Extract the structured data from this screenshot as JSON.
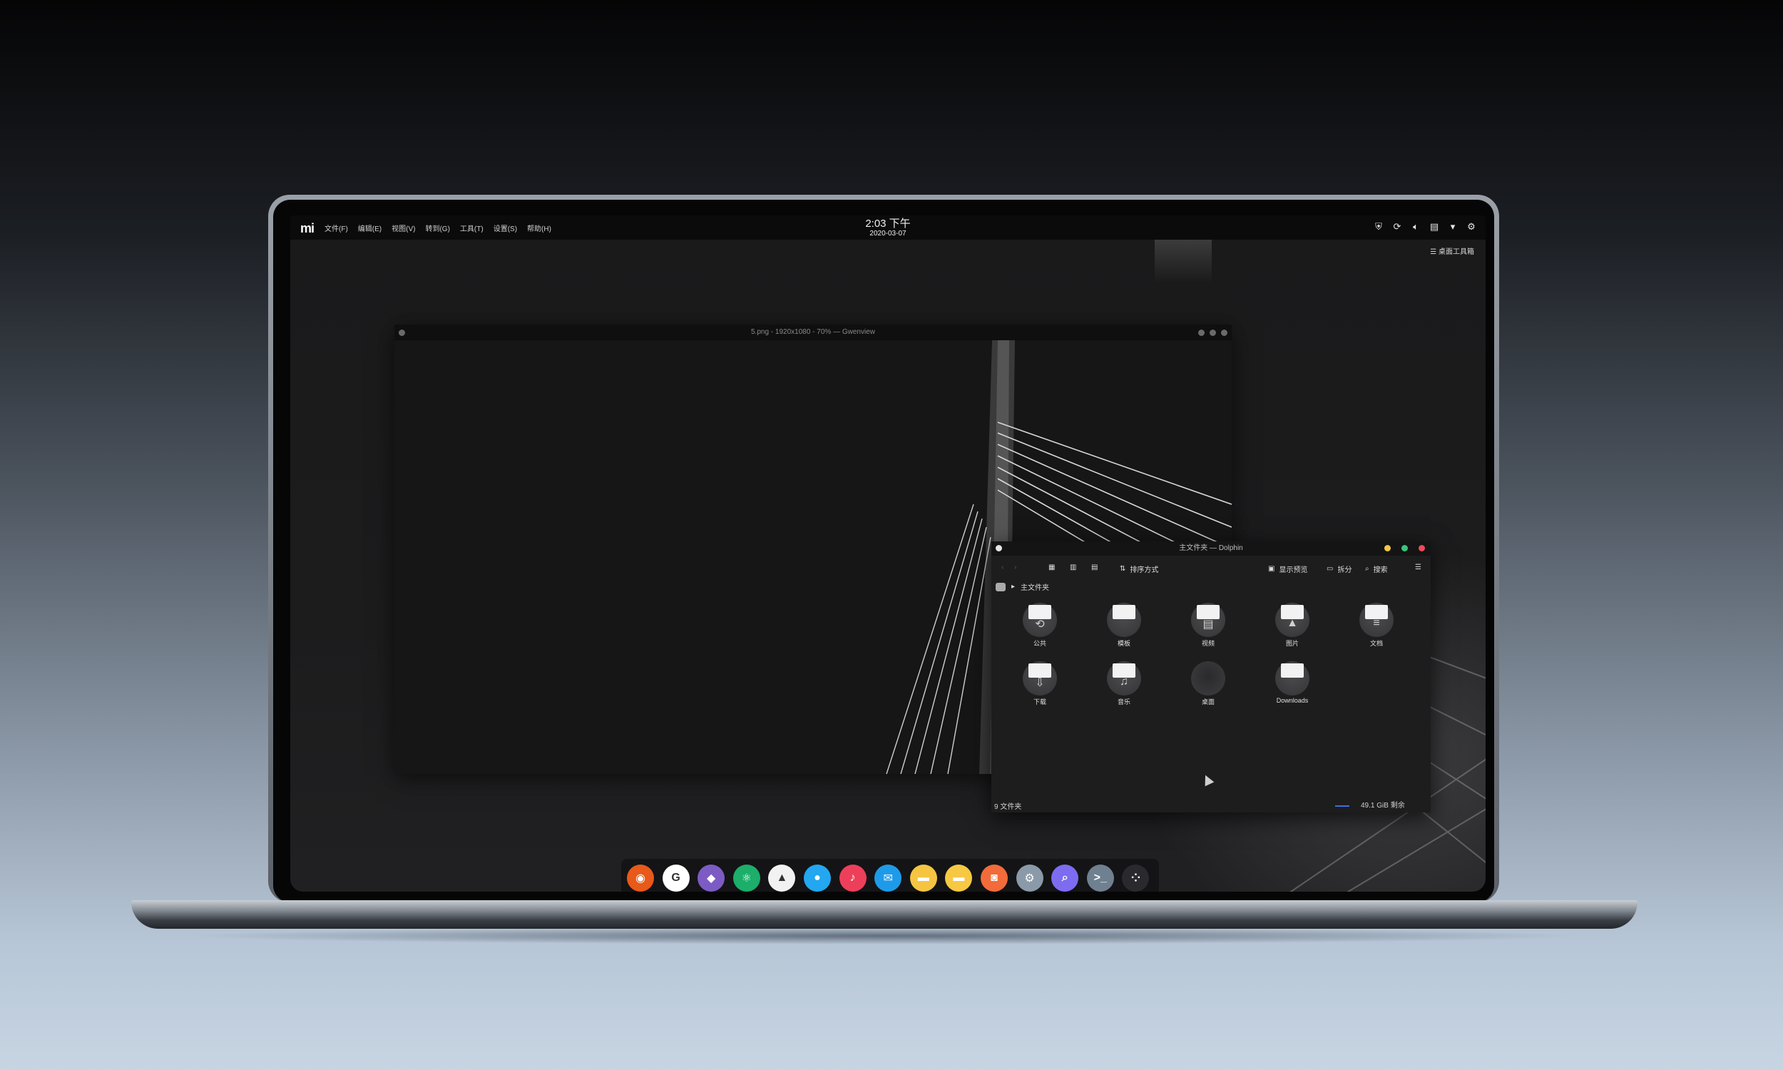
{
  "topbar": {
    "logo": "mi",
    "menu": [
      "文件(F)",
      "编辑(E)",
      "视图(V)",
      "转到(G)",
      "工具(T)",
      "设置(S)",
      "帮助(H)"
    ],
    "time": "2:03 下午",
    "date": "2020-03-07",
    "tray_icons": [
      "shield-icon",
      "sync-icon",
      "volume-icon",
      "clipboard-icon",
      "dropdown-icon",
      "settings-icon"
    ]
  },
  "desktop": {
    "toolbox_label": "桌面工具箱"
  },
  "gwenview": {
    "title": "5.png - 1920x1080 - 70% — Gwenview"
  },
  "dolphin": {
    "title": "主文件夹 — Dolphin",
    "toolbar": {
      "sort_label": "排序方式",
      "preview_label": "显示预览",
      "split_label": "拆分",
      "search_label": "搜索"
    },
    "breadcrumb": "主文件夹",
    "items": [
      {
        "label": "公共",
        "icon": "share-icon",
        "glyph": "⟲"
      },
      {
        "label": "模板",
        "icon": "template-icon",
        "glyph": ""
      },
      {
        "label": "视频",
        "icon": "video-icon",
        "glyph": "▤"
      },
      {
        "label": "图片",
        "icon": "image-icon",
        "glyph": "▲"
      },
      {
        "label": "文档",
        "icon": "document-icon",
        "glyph": "≡"
      },
      {
        "label": "下载",
        "icon": "download-icon",
        "glyph": "⇩"
      },
      {
        "label": "音乐",
        "icon": "music-icon",
        "glyph": "♫"
      },
      {
        "label": "桌面",
        "icon": "desktop-icon",
        "glyph": ""
      },
      {
        "label": "Downloads",
        "icon": "folder-icon",
        "glyph": ""
      }
    ],
    "status_left": "9 文件夹",
    "status_right": "49.1 GiB 剩余"
  },
  "dock": {
    "apps": [
      {
        "name": "firefox-icon",
        "color": "#e8591a",
        "glyph": "◉"
      },
      {
        "name": "google-icon",
        "color": "#ffffff",
        "glyph": "G"
      },
      {
        "name": "github-icon",
        "color": "#7c5cc4",
        "glyph": "◆"
      },
      {
        "name": "atom-icon",
        "color": "#1cae6a",
        "glyph": "⚛"
      },
      {
        "name": "inkscape-icon",
        "color": "#f2f2f2",
        "glyph": "▲"
      },
      {
        "name": "qq-icon",
        "color": "#22a7f0",
        "glyph": "●"
      },
      {
        "name": "music-app-icon",
        "color": "#ee3f5a",
        "glyph": "♪"
      },
      {
        "name": "mail-icon",
        "color": "#1e9be8",
        "glyph": "✉"
      },
      {
        "name": "files-icon",
        "color": "#f5c542",
        "glyph": "▬"
      },
      {
        "name": "notes-icon",
        "color": "#f7c843",
        "glyph": "▬"
      },
      {
        "name": "store-icon",
        "color": "#f26b3a",
        "glyph": "◙"
      },
      {
        "name": "system-settings-icon",
        "color": "#8a9aa8",
        "glyph": "⚙"
      },
      {
        "name": "search-app-icon",
        "color": "#7d6cf0",
        "glyph": "⌕"
      },
      {
        "name": "terminal-icon",
        "color": "#6f8090",
        "glyph": ">_"
      },
      {
        "name": "launcher-icon",
        "color": "#2a2a2e",
        "glyph": "⁘"
      }
    ]
  }
}
